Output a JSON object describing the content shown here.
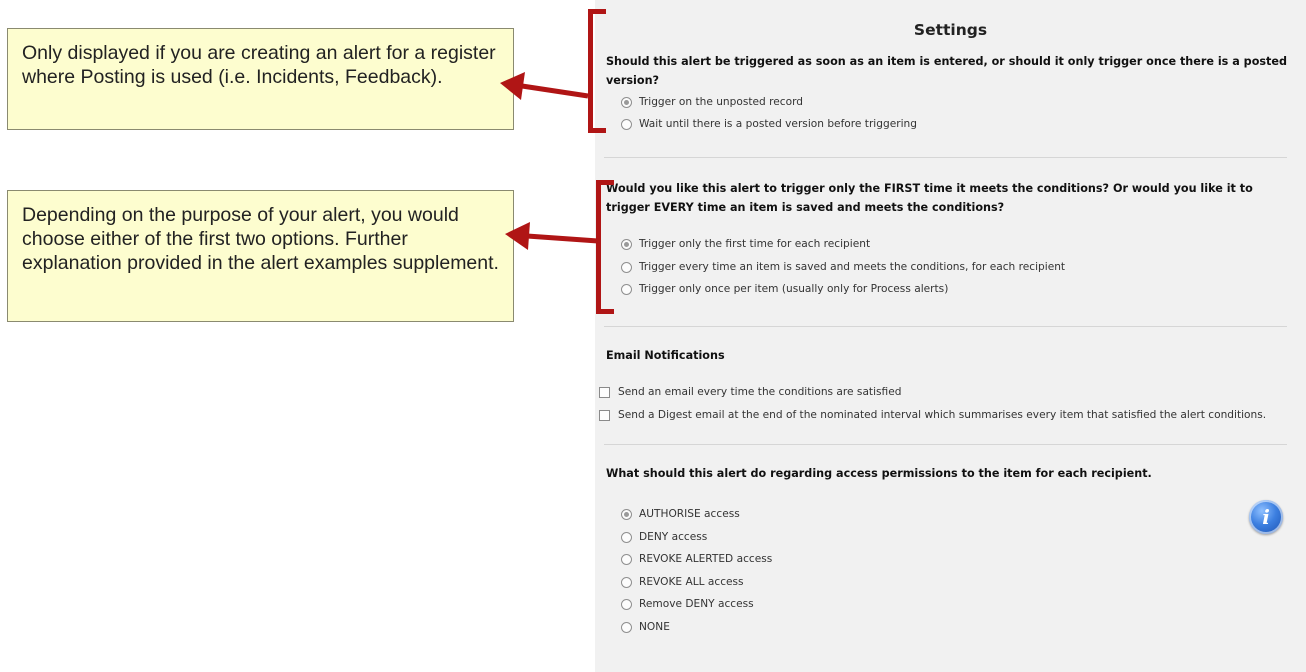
{
  "callouts": [
    {
      "text": "Only displayed if you are creating an alert for a register where Posting is used (i.e. Incidents, Feedback)."
    },
    {
      "text": "Depending on the purpose of your alert, you would choose either of the first two options. Further explanation provided in the alert examples supplement."
    }
  ],
  "settings": {
    "title": "Settings",
    "posting": {
      "question": "Should this alert be triggered as soon as an item is entered, or should it only trigger once there is a posted version?",
      "options": [
        "Trigger on the unposted record",
        "Wait until there is a posted version before triggering"
      ],
      "selected": 0
    },
    "frequency": {
      "question": "Would you like this alert to trigger only the FIRST time it meets the conditions? Or would you like it to trigger EVERY time an item is saved and meets the conditions?",
      "options": [
        "Trigger only the first time for each recipient",
        "Trigger every time an item is saved and meets the conditions, for each recipient",
        "Trigger only once per item (usually only for Process alerts)"
      ],
      "selected": 0
    },
    "email": {
      "heading": "Email Notifications",
      "options": [
        "Send an email every time the conditions are satisfied",
        "Send a Digest email at the end of the nominated interval which summarises every item that satisfied the alert conditions."
      ],
      "checked": [
        false,
        false
      ]
    },
    "permissions": {
      "question": "What should this alert do regarding access permissions to the item for each recipient.",
      "options": [
        "AUTHORISE access",
        "DENY access",
        "REVOKE ALERTED access",
        "REVOKE ALL access",
        "Remove DENY access",
        "NONE"
      ],
      "selected": 0
    },
    "info_icon": "info-icon"
  },
  "colors": {
    "callout_bg": "#fdfdcf",
    "annotation_red": "#b01515",
    "panel_bg": "#f1f1f1"
  }
}
